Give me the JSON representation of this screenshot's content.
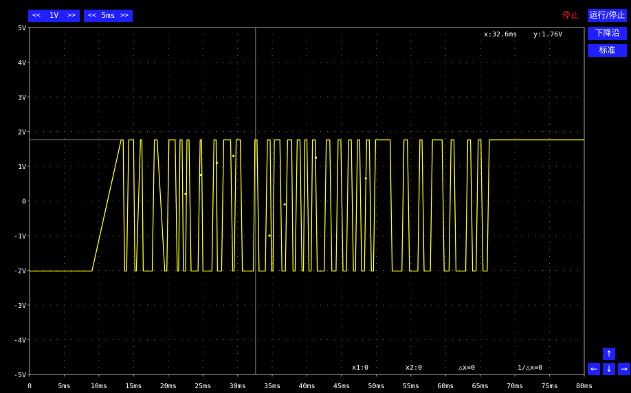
{
  "top_controls": {
    "volt_scale": {
      "left_arrow": "<<",
      "value": "1V",
      "right_arrow": ">>"
    },
    "time_scale": {
      "left_arrow": "<<",
      "value": "5ms",
      "right_arrow": ">>"
    }
  },
  "status_text": "停止",
  "side_buttons": {
    "run_stop": "运行/停止",
    "falling_edge": "下降沿",
    "standard": "标准"
  },
  "cursor_readout": {
    "x": "x:32.6ms",
    "y": "y:1.76V"
  },
  "measurements": {
    "x1": "x1:0",
    "x2": "x2:0",
    "dx": "△x=0",
    "inv_dx": "1/△x=0"
  },
  "nav_arrows": {
    "up": "↑",
    "down": "↓",
    "left": "←",
    "right": "→"
  },
  "colors": {
    "trace": "#ffff00",
    "grid_dots": "#7a7a7a",
    "frame": "#a0a0a0",
    "button": "#1f1fff",
    "status": "#ff2020"
  },
  "chart_data": {
    "type": "line",
    "xlabel": "",
    "ylabel": "",
    "x_ticks": [
      "0",
      "5ms",
      "10ms",
      "15ms",
      "20ms",
      "25ms",
      "30ms",
      "35ms",
      "40ms",
      "45ms",
      "50ms",
      "55ms",
      "60ms",
      "65ms",
      "70ms",
      "75ms",
      "80ms"
    ],
    "y_ticks": [
      "5V",
      "4V",
      "3V",
      "2V",
      "1V",
      "0",
      "-1V",
      "-2V",
      "-3V",
      "-4V",
      "-5V"
    ],
    "xlim": [
      0,
      80
    ],
    "ylim": [
      -5,
      5
    ],
    "cursor": {
      "x_ms": 32.6,
      "y_v": 1.76
    },
    "series": [
      {
        "x": [
          0,
          5.5,
          9.0,
          13.2,
          13.5,
          13.7,
          14.0,
          14.3,
          15.0,
          15.2,
          15.4,
          16.0,
          16.2,
          16.4,
          17.7,
          18.0,
          18.4,
          19.5,
          19.8,
          20.1,
          21.0,
          21.3,
          21.5,
          21.7,
          22.0,
          22.2,
          22.5,
          22.7,
          23.0,
          23.3,
          24.3,
          24.6,
          24.8,
          25.0,
          26.3,
          26.6,
          26.9,
          27.1,
          27.7,
          28.0,
          29.0,
          29.3,
          29.5,
          29.8,
          30.4,
          30.7,
          32.3,
          32.5,
          32.8,
          33.1,
          34.0,
          34.3,
          34.7,
          34.9,
          35.1,
          35.3,
          36.1,
          36.4,
          36.9,
          37.2,
          37.8,
          38.0,
          38.3,
          38.6,
          39.0,
          39.3,
          39.5,
          39.7,
          40.0,
          40.3,
          40.6,
          40.8,
          41.2,
          41.5,
          42.5,
          42.8,
          43.3,
          43.6,
          44.2,
          44.5,
          44.9,
          45.2,
          45.7,
          46.0,
          46.4,
          46.7,
          47.0,
          47.3,
          47.6,
          47.9,
          48.3,
          48.6,
          49.0,
          49.3,
          49.6,
          49.9,
          52.0,
          52.3,
          53.7,
          54.0,
          54.5,
          54.8,
          56.0,
          56.3,
          56.6,
          56.9,
          57.8,
          58.1,
          59.5,
          59.8,
          60.5,
          60.8,
          61.2,
          61.5,
          62.9,
          63.2,
          63.6,
          63.9,
          64.4,
          64.7,
          65.1,
          65.4,
          66.0,
          66.3,
          79.5,
          80.0
        ],
        "y": [
          -2.02,
          -2.02,
          -2.02,
          1.76,
          1.76,
          -2.02,
          -2.02,
          1.76,
          1.76,
          -2.02,
          -2.02,
          1.76,
          1.76,
          -2.02,
          -2.02,
          1.76,
          1.76,
          -2.02,
          -2.02,
          1.76,
          1.76,
          -2.02,
          -2.02,
          1.76,
          1.76,
          -2.02,
          -2.02,
          1.76,
          1.76,
          -2.02,
          -2.02,
          1.76,
          1.76,
          -2.02,
          -2.02,
          1.76,
          1.76,
          -2.02,
          -2.02,
          1.76,
          1.76,
          -2.02,
          -2.02,
          1.76,
          1.76,
          -2.02,
          -2.02,
          1.76,
          1.76,
          -2.02,
          -2.02,
          1.76,
          1.76,
          -2.02,
          -2.02,
          1.76,
          1.76,
          -2.02,
          -2.02,
          1.76,
          1.76,
          -2.02,
          -2.02,
          1.76,
          1.76,
          -2.02,
          -2.02,
          1.76,
          1.76,
          -2.02,
          -2.02,
          1.76,
          1.76,
          -2.02,
          -2.02,
          1.76,
          1.76,
          -2.02,
          -2.02,
          1.76,
          1.76,
          -2.02,
          -2.02,
          1.76,
          1.76,
          -2.02,
          -2.02,
          1.76,
          1.76,
          -2.02,
          -2.02,
          1.76,
          1.76,
          -2.02,
          -2.02,
          1.76,
          1.76,
          -2.02,
          -2.02,
          1.76,
          1.76,
          -2.02,
          -2.02,
          1.76,
          1.76,
          -2.02,
          -2.02,
          1.76,
          1.76,
          -2.02,
          -2.02,
          1.76,
          1.76,
          -2.02,
          -2.02,
          1.76,
          1.76,
          -2.02,
          -2.02,
          1.76,
          1.76,
          -2.02,
          -2.02,
          1.76,
          1.76,
          1.76
        ]
      }
    ],
    "stray_points": [
      {
        "x": 22.5,
        "y": 0.2
      },
      {
        "x": 24.7,
        "y": 0.75
      },
      {
        "x": 27.0,
        "y": 1.1
      },
      {
        "x": 29.4,
        "y": 1.3
      },
      {
        "x": 34.6,
        "y": -1.0
      },
      {
        "x": 36.8,
        "y": -0.1
      },
      {
        "x": 41.3,
        "y": 1.25
      },
      {
        "x": 48.5,
        "y": 0.65
      }
    ]
  }
}
